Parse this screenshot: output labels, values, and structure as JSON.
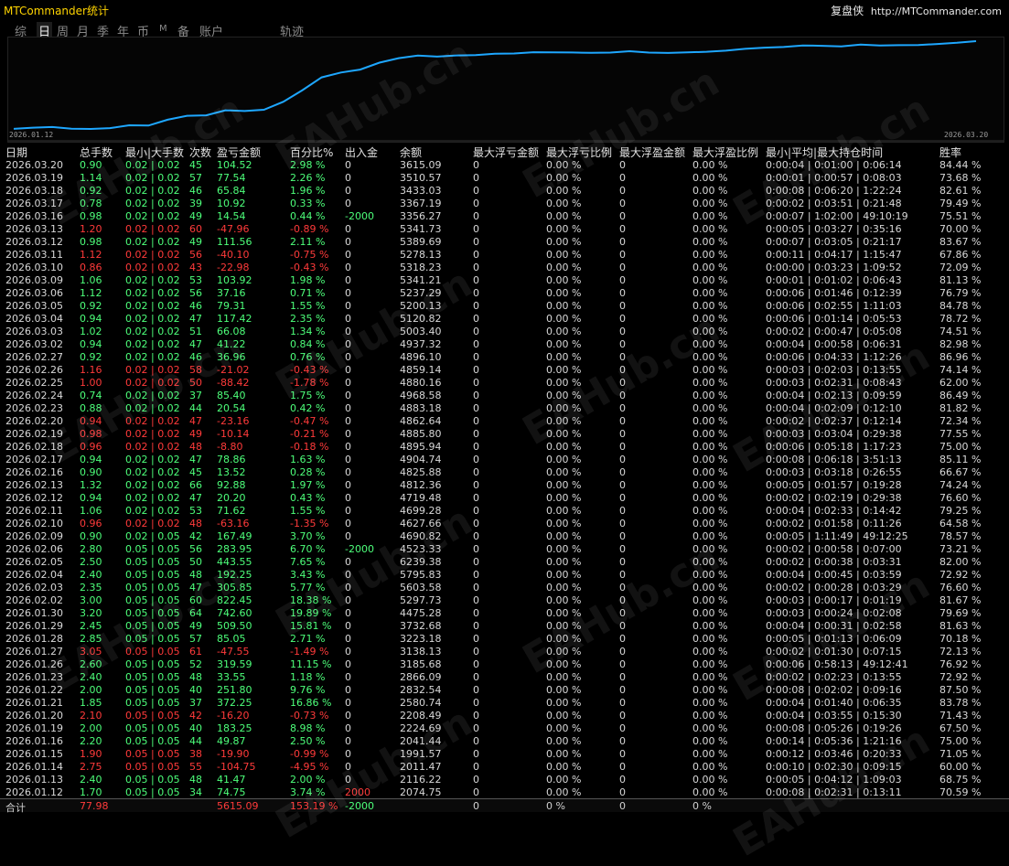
{
  "app_title": "MTCommander统计",
  "brand": {
    "name": "复盘侠",
    "url": "http://MTCommander.com"
  },
  "tabs": [
    "综",
    "日",
    "周",
    "月",
    "季",
    "年",
    "币",
    "M",
    "备",
    "账户",
    "轨迹"
  ],
  "active_tab": "日",
  "chart": {
    "start_date": "2026.01.12",
    "end_date": "2026.03.20",
    "line_color": "#1ea7ff"
  },
  "watermark": "EAHub.cn",
  "colors": {
    "loss": "#ff3a3a",
    "profit": "#4dff7a",
    "text": "#d8d8d8",
    "title": "#ffd400"
  },
  "headers": [
    "日期",
    "总手数",
    "最小|大手数",
    "次数",
    "盈亏金额",
    "百分比%",
    "出入金",
    "余额",
    "最大浮亏金额",
    "最大浮亏比例",
    "最大浮盈金额",
    "最大浮盈比例",
    "最小|平均|最大持仓时间",
    "胜率"
  ],
  "rows": [
    [
      "2026.03.20",
      "0.90",
      "0.02 | 0.02",
      "45",
      "104.52",
      "2.98 %",
      "0",
      "3615.09",
      "0",
      "0.00 %",
      "0",
      "0.00 %",
      "0:00:04 | 0:01:00 | 0:06:14",
      "84.44 %"
    ],
    [
      "2026.03.19",
      "1.14",
      "0.02 | 0.02",
      "57",
      "77.54",
      "2.26 %",
      "0",
      "3510.57",
      "0",
      "0.00 %",
      "0",
      "0.00 %",
      "0:00:01 | 0:00:57 | 0:08:03",
      "73.68 %"
    ],
    [
      "2026.03.18",
      "0.92",
      "0.02 | 0.02",
      "46",
      "65.84",
      "1.96 %",
      "0",
      "3433.03",
      "0",
      "0.00 %",
      "0",
      "0.00 %",
      "0:00:08 | 0:06:20 | 1:22:24",
      "82.61 %"
    ],
    [
      "2026.03.17",
      "0.78",
      "0.02 | 0.02",
      "39",
      "10.92",
      "0.33 %",
      "0",
      "3367.19",
      "0",
      "0.00 %",
      "0",
      "0.00 %",
      "0:00:02 | 0:03:51 | 0:21:48",
      "79.49 %"
    ],
    [
      "2026.03.16",
      "0.98",
      "0.02 | 0.02",
      "49",
      "14.54",
      "0.44 %",
      "-2000",
      "3356.27",
      "0",
      "0.00 %",
      "0",
      "0.00 %",
      "0:00:07 | 1:02:00 | 49:10:19",
      "75.51 %"
    ],
    [
      "2026.03.13",
      "1.20",
      "0.02 | 0.02",
      "60",
      "-47.96",
      "-0.89 %",
      "0",
      "5341.73",
      "0",
      "0.00 %",
      "0",
      "0.00 %",
      "0:00:05 | 0:03:27 | 0:35:16",
      "70.00 %"
    ],
    [
      "2026.03.12",
      "0.98",
      "0.02 | 0.02",
      "49",
      "111.56",
      "2.11 %",
      "0",
      "5389.69",
      "0",
      "0.00 %",
      "0",
      "0.00 %",
      "0:00:07 | 0:03:05 | 0:21:17",
      "83.67 %"
    ],
    [
      "2026.03.11",
      "1.12",
      "0.02 | 0.02",
      "56",
      "-40.10",
      "-0.75 %",
      "0",
      "5278.13",
      "0",
      "0.00 %",
      "0",
      "0.00 %",
      "0:00:11 | 0:04:17 | 1:15:47",
      "67.86 %"
    ],
    [
      "2026.03.10",
      "0.86",
      "0.02 | 0.02",
      "43",
      "-22.98",
      "-0.43 %",
      "0",
      "5318.23",
      "0",
      "0.00 %",
      "0",
      "0.00 %",
      "0:00:00 | 0:03:23 | 1:09:52",
      "72.09 %"
    ],
    [
      "2026.03.09",
      "1.06",
      "0.02 | 0.02",
      "53",
      "103.92",
      "1.98 %",
      "0",
      "5341.21",
      "0",
      "0.00 %",
      "0",
      "0.00 %",
      "0:00:01 | 0:01:02 | 0:06:43",
      "81.13 %"
    ],
    [
      "2026.03.06",
      "1.12",
      "0.02 | 0.02",
      "56",
      "37.16",
      "0.71 %",
      "0",
      "5237.29",
      "0",
      "0.00 %",
      "0",
      "0.00 %",
      "0:00:06 | 0:01:46 | 0:12:39",
      "76.79 %"
    ],
    [
      "2026.03.05",
      "0.92",
      "0.02 | 0.02",
      "46",
      "79.31",
      "1.55 %",
      "0",
      "5200.13",
      "0",
      "0.00 %",
      "0",
      "0.00 %",
      "0:00:06 | 0:02:55 | 1:11:03",
      "84.78 %"
    ],
    [
      "2026.03.04",
      "0.94",
      "0.02 | 0.02",
      "47",
      "117.42",
      "2.35 %",
      "0",
      "5120.82",
      "0",
      "0.00 %",
      "0",
      "0.00 %",
      "0:00:06 | 0:01:14 | 0:05:53",
      "78.72 %"
    ],
    [
      "2026.03.03",
      "1.02",
      "0.02 | 0.02",
      "51",
      "66.08",
      "1.34 %",
      "0",
      "5003.40",
      "0",
      "0.00 %",
      "0",
      "0.00 %",
      "0:00:02 | 0:00:47 | 0:05:08",
      "74.51 %"
    ],
    [
      "2026.03.02",
      "0.94",
      "0.02 | 0.02",
      "47",
      "41.22",
      "0.84 %",
      "0",
      "4937.32",
      "0",
      "0.00 %",
      "0",
      "0.00 %",
      "0:00:04 | 0:00:58 | 0:06:31",
      "82.98 %"
    ],
    [
      "2026.02.27",
      "0.92",
      "0.02 | 0.02",
      "46",
      "36.96",
      "0.76 %",
      "0",
      "4896.10",
      "0",
      "0.00 %",
      "0",
      "0.00 %",
      "0:00:06 | 0:04:33 | 1:12:26",
      "86.96 %"
    ],
    [
      "2026.02.26",
      "1.16",
      "0.02 | 0.02",
      "58",
      "-21.02",
      "-0.43 %",
      "0",
      "4859.14",
      "0",
      "0.00 %",
      "0",
      "0.00 %",
      "0:00:03 | 0:02:03 | 0:13:55",
      "74.14 %"
    ],
    [
      "2026.02.25",
      "1.00",
      "0.02 | 0.02",
      "50",
      "-88.42",
      "-1.78 %",
      "0",
      "4880.16",
      "0",
      "0.00 %",
      "0",
      "0.00 %",
      "0:00:03 | 0:02:31 | 0:08:43",
      "62.00 %"
    ],
    [
      "2026.02.24",
      "0.74",
      "0.02 | 0.02",
      "37",
      "85.40",
      "1.75 %",
      "0",
      "4968.58",
      "0",
      "0.00 %",
      "0",
      "0.00 %",
      "0:00:04 | 0:02:13 | 0:09:59",
      "86.49 %"
    ],
    [
      "2026.02.23",
      "0.88",
      "0.02 | 0.02",
      "44",
      "20.54",
      "0.42 %",
      "0",
      "4883.18",
      "0",
      "0.00 %",
      "0",
      "0.00 %",
      "0:00:04 | 0:02:09 | 0:12:10",
      "81.82 %"
    ],
    [
      "2026.02.20",
      "0.94",
      "0.02 | 0.02",
      "47",
      "-23.16",
      "-0.47 %",
      "0",
      "4862.64",
      "0",
      "0.00 %",
      "0",
      "0.00 %",
      "0:00:02 | 0:02:37 | 0:12:14",
      "72.34 %"
    ],
    [
      "2026.02.19",
      "0.98",
      "0.02 | 0.02",
      "49",
      "-10.14",
      "-0.21 %",
      "0",
      "4885.80",
      "0",
      "0.00 %",
      "0",
      "0.00 %",
      "0:00:03 | 0:03:04 | 0:29:38",
      "77.55 %"
    ],
    [
      "2026.02.18",
      "0.96",
      "0.02 | 0.02",
      "48",
      "-8.80",
      "-0.18 %",
      "0",
      "4895.94",
      "0",
      "0.00 %",
      "0",
      "0.00 %",
      "0:00:06 | 0:05:18 | 1:17:23",
      "75.00 %"
    ],
    [
      "2026.02.17",
      "0.94",
      "0.02 | 0.02",
      "47",
      "78.86",
      "1.63 %",
      "0",
      "4904.74",
      "0",
      "0.00 %",
      "0",
      "0.00 %",
      "0:00:08 | 0:06:18 | 3:51:13",
      "85.11 %"
    ],
    [
      "2026.02.16",
      "0.90",
      "0.02 | 0.02",
      "45",
      "13.52",
      "0.28 %",
      "0",
      "4825.88",
      "0",
      "0.00 %",
      "0",
      "0.00 %",
      "0:00:03 | 0:03:18 | 0:26:55",
      "66.67 %"
    ],
    [
      "2026.02.13",
      "1.32",
      "0.02 | 0.02",
      "66",
      "92.88",
      "1.97 %",
      "0",
      "4812.36",
      "0",
      "0.00 %",
      "0",
      "0.00 %",
      "0:00:05 | 0:01:57 | 0:19:28",
      "74.24 %"
    ],
    [
      "2026.02.12",
      "0.94",
      "0.02 | 0.02",
      "47",
      "20.20",
      "0.43 %",
      "0",
      "4719.48",
      "0",
      "0.00 %",
      "0",
      "0.00 %",
      "0:00:02 | 0:02:19 | 0:29:38",
      "76.60 %"
    ],
    [
      "2026.02.11",
      "1.06",
      "0.02 | 0.02",
      "53",
      "71.62",
      "1.55 %",
      "0",
      "4699.28",
      "0",
      "0.00 %",
      "0",
      "0.00 %",
      "0:00:04 | 0:02:33 | 0:14:42",
      "79.25 %"
    ],
    [
      "2026.02.10",
      "0.96",
      "0.02 | 0.02",
      "48",
      "-63.16",
      "-1.35 %",
      "0",
      "4627.66",
      "0",
      "0.00 %",
      "0",
      "0.00 %",
      "0:00:02 | 0:01:58 | 0:11:26",
      "64.58 %"
    ],
    [
      "2026.02.09",
      "0.90",
      "0.02 | 0.05",
      "42",
      "167.49",
      "3.70 %",
      "0",
      "4690.82",
      "0",
      "0.00 %",
      "0",
      "0.00 %",
      "0:00:05 | 1:11:49 | 49:12:25",
      "78.57 %"
    ],
    [
      "2026.02.06",
      "2.80",
      "0.05 | 0.05",
      "56",
      "283.95",
      "6.70 %",
      "-2000",
      "4523.33",
      "0",
      "0.00 %",
      "0",
      "0.00 %",
      "0:00:02 | 0:00:58 | 0:07:00",
      "73.21 %"
    ],
    [
      "2026.02.05",
      "2.50",
      "0.05 | 0.05",
      "50",
      "443.55",
      "7.65 %",
      "0",
      "6239.38",
      "0",
      "0.00 %",
      "0",
      "0.00 %",
      "0:00:02 | 0:00:38 | 0:03:31",
      "82.00 %"
    ],
    [
      "2026.02.04",
      "2.40",
      "0.05 | 0.05",
      "48",
      "192.25",
      "3.43 %",
      "0",
      "5795.83",
      "0",
      "0.00 %",
      "0",
      "0.00 %",
      "0:00:04 | 0:00:45 | 0:03:59",
      "72.92 %"
    ],
    [
      "2026.02.03",
      "2.35",
      "0.05 | 0.05",
      "47",
      "305.85",
      "5.77 %",
      "0",
      "5603.58",
      "0",
      "0.00 %",
      "0",
      "0.00 %",
      "0:00:02 | 0:00:28 | 0:03:29",
      "76.60 %"
    ],
    [
      "2026.02.02",
      "3.00",
      "0.05 | 0.05",
      "60",
      "822.45",
      "18.38 %",
      "0",
      "5297.73",
      "0",
      "0.00 %",
      "0",
      "0.00 %",
      "0:00:03 | 0:00:17 | 0:01:19",
      "81.67 %"
    ],
    [
      "2026.01.30",
      "3.20",
      "0.05 | 0.05",
      "64",
      "742.60",
      "19.89 %",
      "0",
      "4475.28",
      "0",
      "0.00 %",
      "0",
      "0.00 %",
      "0:00:03 | 0:00:24 | 0:02:08",
      "79.69 %"
    ],
    [
      "2026.01.29",
      "2.45",
      "0.05 | 0.05",
      "49",
      "509.50",
      "15.81 %",
      "0",
      "3732.68",
      "0",
      "0.00 %",
      "0",
      "0.00 %",
      "0:00:04 | 0:00:31 | 0:02:58",
      "81.63 %"
    ],
    [
      "2026.01.28",
      "2.85",
      "0.05 | 0.05",
      "57",
      "85.05",
      "2.71 %",
      "0",
      "3223.18",
      "0",
      "0.00 %",
      "0",
      "0.00 %",
      "0:00:05 | 0:01:13 | 0:06:09",
      "70.18 %"
    ],
    [
      "2026.01.27",
      "3.05",
      "0.05 | 0.05",
      "61",
      "-47.55",
      "-1.49 %",
      "0",
      "3138.13",
      "0",
      "0.00 %",
      "0",
      "0.00 %",
      "0:00:02 | 0:01:30 | 0:07:15",
      "72.13 %"
    ],
    [
      "2026.01.26",
      "2.60",
      "0.05 | 0.05",
      "52",
      "319.59",
      "11.15 %",
      "0",
      "3185.68",
      "0",
      "0.00 %",
      "0",
      "0.00 %",
      "0:00:06 | 0:58:13 | 49:12:41",
      "76.92 %"
    ],
    [
      "2026.01.23",
      "2.40",
      "0.05 | 0.05",
      "48",
      "33.55",
      "1.18 %",
      "0",
      "2866.09",
      "0",
      "0.00 %",
      "0",
      "0.00 %",
      "0:00:02 | 0:02:23 | 0:13:55",
      "72.92 %"
    ],
    [
      "2026.01.22",
      "2.00",
      "0.05 | 0.05",
      "40",
      "251.80",
      "9.76 %",
      "0",
      "2832.54",
      "0",
      "0.00 %",
      "0",
      "0.00 %",
      "0:00:08 | 0:02:02 | 0:09:16",
      "87.50 %"
    ],
    [
      "2026.01.21",
      "1.85",
      "0.05 | 0.05",
      "37",
      "372.25",
      "16.86 %",
      "0",
      "2580.74",
      "0",
      "0.00 %",
      "0",
      "0.00 %",
      "0:00:04 | 0:01:40 | 0:06:35",
      "83.78 %"
    ],
    [
      "2026.01.20",
      "2.10",
      "0.05 | 0.05",
      "42",
      "-16.20",
      "-0.73 %",
      "0",
      "2208.49",
      "0",
      "0.00 %",
      "0",
      "0.00 %",
      "0:00:04 | 0:03:55 | 0:15:30",
      "71.43 %"
    ],
    [
      "2026.01.19",
      "2.00",
      "0.05 | 0.05",
      "40",
      "183.25",
      "8.98 %",
      "0",
      "2224.69",
      "0",
      "0.00 %",
      "0",
      "0.00 %",
      "0:00:08 | 0:05:26 | 0:19:26",
      "67.50 %"
    ],
    [
      "2026.01.16",
      "2.20",
      "0.05 | 0.05",
      "44",
      "49.87",
      "2.50 %",
      "0",
      "2041.44",
      "0",
      "0.00 %",
      "0",
      "0.00 %",
      "0:00:14 | 0:05:36 | 1:21:16",
      "75.00 %"
    ],
    [
      "2026.01.15",
      "1.90",
      "0.05 | 0.05",
      "38",
      "-19.90",
      "-0.99 %",
      "0",
      "1991.57",
      "0",
      "0.00 %",
      "0",
      "0.00 %",
      "0:00:12 | 0:03:46 | 0:20:33",
      "71.05 %"
    ],
    [
      "2026.01.14",
      "2.75",
      "0.05 | 0.05",
      "55",
      "-104.75",
      "-4.95 %",
      "0",
      "2011.47",
      "0",
      "0.00 %",
      "0",
      "0.00 %",
      "0:00:10 | 0:02:30 | 0:09:15",
      "60.00 %"
    ],
    [
      "2026.01.13",
      "2.40",
      "0.05 | 0.05",
      "48",
      "41.47",
      "2.00 %",
      "0",
      "2116.22",
      "0",
      "0.00 %",
      "0",
      "0.00 %",
      "0:00:05 | 0:04:12 | 1:09:03",
      "68.75 %"
    ],
    [
      "2026.01.12",
      "1.70",
      "0.05 | 0.05",
      "34",
      "74.75",
      "3.74 %",
      "2000",
      "2074.75",
      "0",
      "0.00 %",
      "0",
      "0.00 %",
      "0:00:08 | 0:02:31 | 0:13:11",
      "70.59 %"
    ]
  ],
  "footer": [
    "合计",
    "77.98",
    "",
    "",
    "5615.09",
    "153.19 %",
    "-2000",
    "",
    "0",
    "0 %",
    "0",
    "0 %",
    "",
    ""
  ]
}
